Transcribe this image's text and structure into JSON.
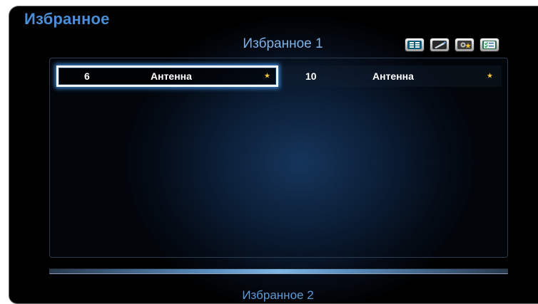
{
  "title": "Избранное",
  "list": {
    "title": "Избранное 1",
    "channels": [
      {
        "number": "6",
        "name": "Антенна",
        "star": "★",
        "selected": true
      },
      {
        "number": "10",
        "name": "Антенна",
        "star": "★",
        "selected": false
      }
    ]
  },
  "next_list": {
    "title": "Избранное 2"
  },
  "tools": [
    {
      "icon": "list-view-icon"
    },
    {
      "icon": "edit-pencil-icon"
    },
    {
      "icon": "tools-star-icon"
    },
    {
      "icon": "checklist-icon"
    }
  ],
  "colors": {
    "title": "#4a8ed8",
    "accent": "#3f8ee0",
    "star": "#f6c232"
  }
}
